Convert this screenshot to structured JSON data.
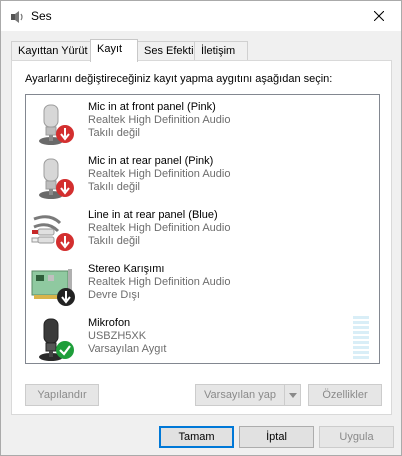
{
  "window": {
    "title": "Ses",
    "icon": "speaker-icon",
    "close_icon": "close-icon"
  },
  "tabs": [
    {
      "label": "Kayıttan Yürüt",
      "active": false
    },
    {
      "label": "Kayıt",
      "active": true
    },
    {
      "label": "Ses Efekti",
      "active": false
    },
    {
      "label": "İletişim",
      "active": false
    }
  ],
  "instruction": "Ayarlarını değiştireceğiniz kayıt yapma aygıtını aşağıdan seçin:",
  "devices": [
    {
      "name": "Mic in at front panel (Pink)",
      "driver": "Realtek High Definition Audio",
      "status": "Takılı değil",
      "icon": "microphone-icon",
      "badge": "unplugged-badge-icon"
    },
    {
      "name": "Mic in at rear panel (Pink)",
      "driver": "Realtek High Definition Audio",
      "status": "Takılı değil",
      "icon": "microphone-icon",
      "badge": "unplugged-badge-icon"
    },
    {
      "name": "Line in at rear panel (Blue)",
      "driver": "Realtek High Definition Audio",
      "status": "Takılı değil",
      "icon": "rca-cable-icon",
      "badge": "unplugged-badge-icon"
    },
    {
      "name": "Stereo Karışımı",
      "driver": "Realtek High Definition Audio",
      "status": "Devre Dışı",
      "icon": "sound-card-icon",
      "badge": "disabled-badge-icon"
    },
    {
      "name": "Mikrofon",
      "driver": "USBZH5XK",
      "status": "Varsayılan Aygıt",
      "icon": "microphone-icon",
      "badge": "default-check-badge-icon",
      "level": 0
    }
  ],
  "buttons": {
    "configure": "Yapılandır",
    "set_default": "Varsayılan yap",
    "properties": "Özellikler",
    "ok": "Tamam",
    "cancel": "İptal",
    "apply": "Uygula"
  },
  "colors": {
    "accent": "#0078d7",
    "unplugged_badge": "#d32f2f",
    "default_badge": "#1e9e3a",
    "disabled_badge": "#222222"
  }
}
